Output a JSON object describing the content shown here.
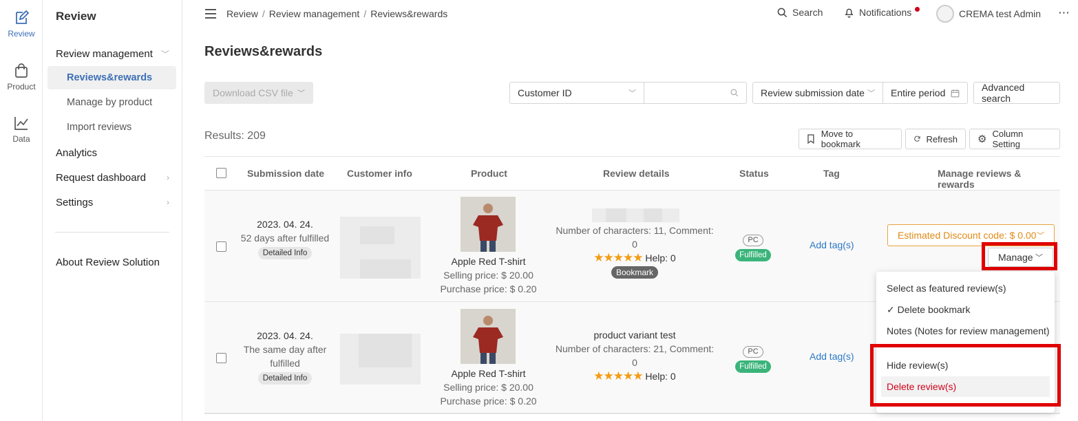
{
  "rail": [
    {
      "label": "Review",
      "icon": "edit-icon",
      "active": true
    },
    {
      "label": "Product",
      "icon": "shopping-bag-icon",
      "active": false
    },
    {
      "label": "Data",
      "icon": "chart-line-icon",
      "active": false
    }
  ],
  "sidebar": {
    "title": "Review",
    "sections": {
      "review_management": "Review management",
      "reviews_rewards": "Reviews&rewards",
      "manage_by_product": "Manage by product",
      "import_reviews": "Import reviews",
      "analytics": "Analytics",
      "request_dashboard": "Request dashboard",
      "settings": "Settings",
      "about": "About Review Solution"
    }
  },
  "header": {
    "breadcrumb": [
      "Review",
      "Review management",
      "Reviews&rewards"
    ],
    "search": "Search",
    "notifications": "Notifications",
    "user": "CREMA test Admin",
    "more": "⋯"
  },
  "page": {
    "title": "Reviews&rewards"
  },
  "toolbar": {
    "download_csv": "Download CSV file",
    "search_field": "Customer ID",
    "search_value": "",
    "date_field": "Review submission date",
    "period": "Entire period",
    "advanced": "Advanced search"
  },
  "results": {
    "label": "Results: 209",
    "bookmark": "Move to bookmark",
    "refresh": "Refresh",
    "column_setting": "Column Setting"
  },
  "table": {
    "columns": [
      "Submission date",
      "Customer info",
      "Product",
      "Review details",
      "Status",
      "Tag",
      "Manage reviews & rewards"
    ],
    "rows": [
      {
        "date": "2023. 04. 24.",
        "relative": "52 days after fulfilled",
        "detail_chip": "Detailed Info",
        "product_name": "Apple Red T-shirt",
        "selling_price": "Selling price: $ 20.00",
        "purchase_price": "Purchase price: $ 0.20",
        "review_title": "",
        "review_chars": "Number of characters: 11, Comment: 0",
        "stars": "★★★★★",
        "help": "Help: 0",
        "bookmark": "Bookmark",
        "platform": "PC",
        "status": "Fulfilled",
        "tag": "Add tag(s)",
        "estimated": "Estimated Discount code: $ 0.00",
        "manage": "Manage"
      },
      {
        "date": "2023. 04. 24.",
        "relative": "The same day after fulfilled",
        "detail_chip": "Detailed Info",
        "product_name": "Apple Red T-shirt",
        "selling_price": "Selling price: $ 20.00",
        "purchase_price": "Purchase price: $ 0.20",
        "review_title": "product variant test",
        "review_chars": "Number of characters: 21, Comment: 0",
        "stars": "★★★★★",
        "help": "Help: 0",
        "platform": "PC",
        "status": "Fulfilled",
        "tag": "Add tag(s)"
      }
    ]
  },
  "manage_menu": {
    "featured": "Select as featured review(s)",
    "delete_bookmark": "✓  Delete bookmark",
    "notes": "Notes (Notes for review management)",
    "hide": "Hide review(s)",
    "delete": "Delete review(s)"
  }
}
